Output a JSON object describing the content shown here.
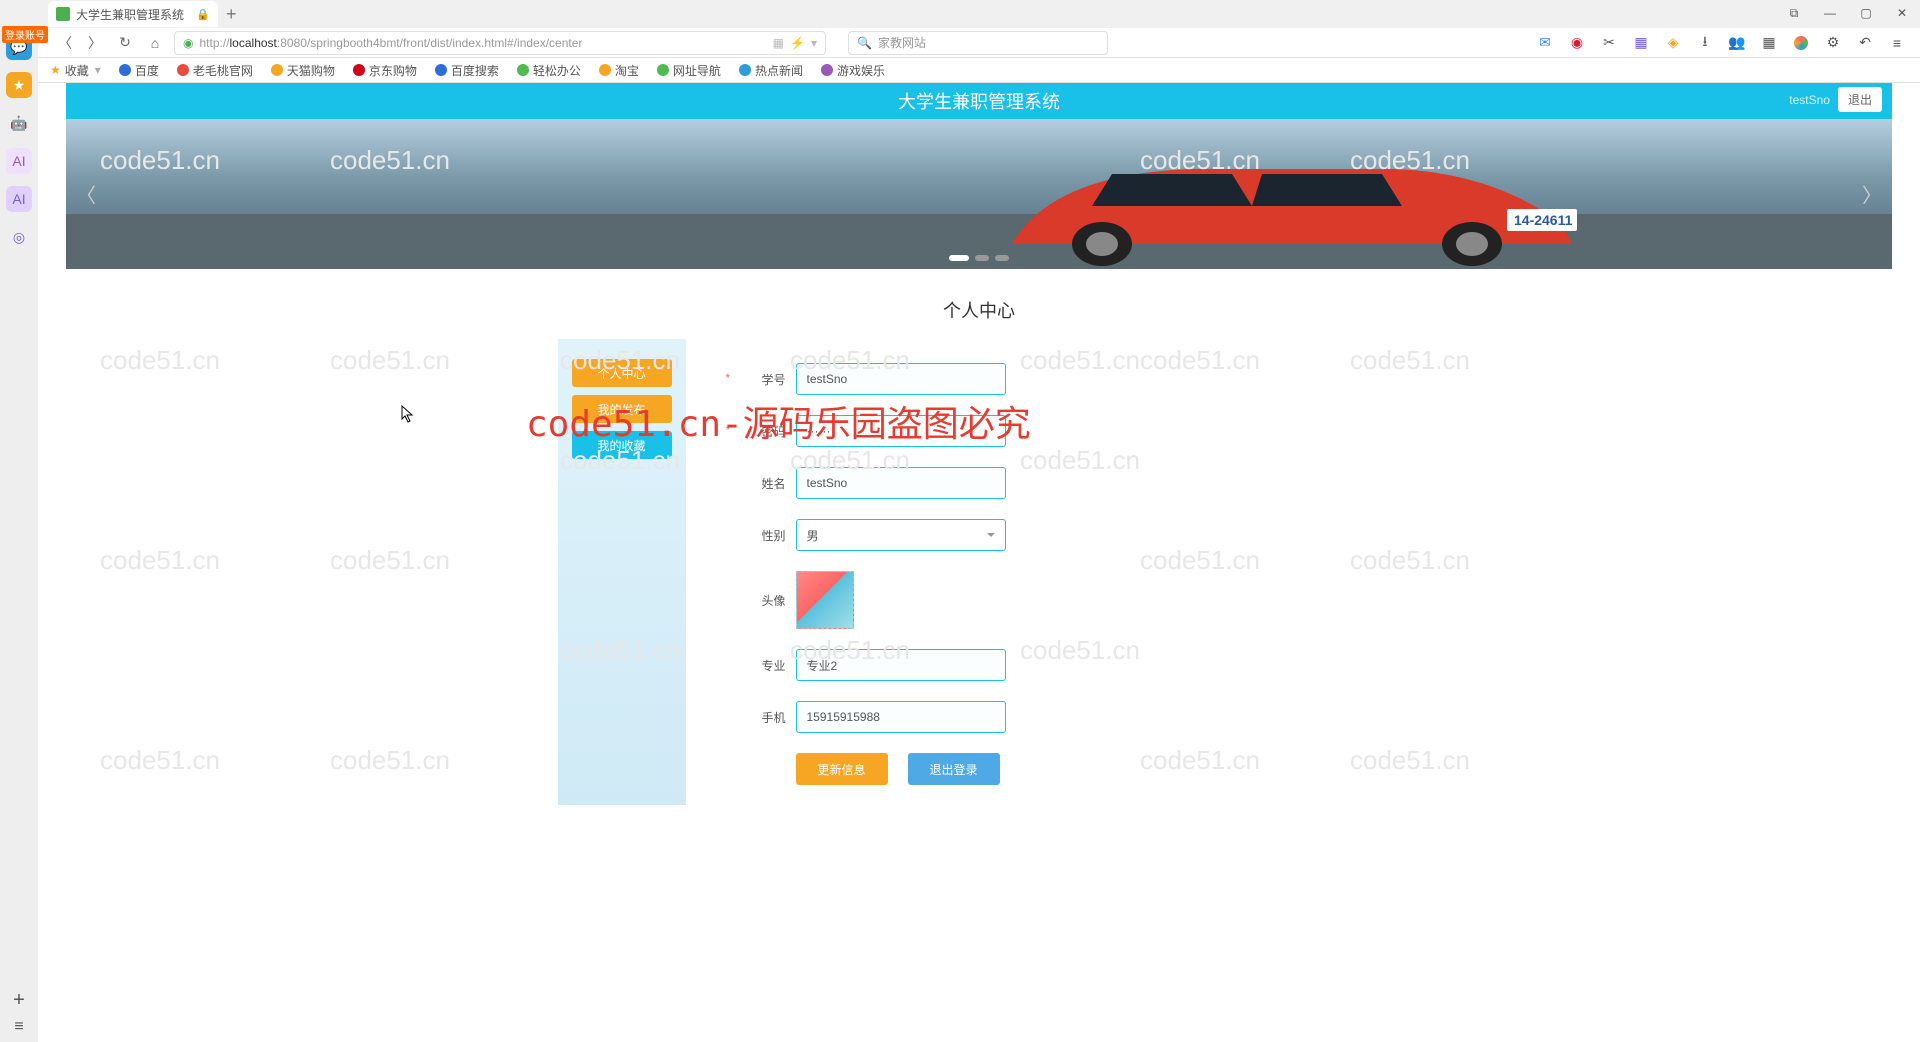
{
  "browser": {
    "tab_title": "大学生兼职管理系统",
    "login_badge": "登录账号",
    "url_prefix": "http://",
    "url_host": "localhost",
    "url_port_path": ":8080/springbooth4bmt/front/dist/index.html#/index/center",
    "search_placeholder": "家教网站"
  },
  "bookmarks": {
    "fav": "收藏",
    "items": [
      "百度",
      "老毛桃官网",
      "天猫购物",
      "京东购物",
      "百度搜索",
      "轻松办公",
      "淘宝",
      "网址导航",
      "热点新闻",
      "游戏娱乐"
    ]
  },
  "app": {
    "title": "大学生兼职管理系统",
    "username": "testSno",
    "logout": "退出"
  },
  "page": {
    "title": "个人中心",
    "sidebar": {
      "personal_center": "个人中心",
      "my_posts": "我的发布",
      "my_favorites": "我的收藏"
    },
    "form": {
      "student_id_label": "学号",
      "student_id_value": "testSno",
      "password_label": "密码",
      "password_value": "······",
      "name_label": "姓名",
      "name_value": "testSno",
      "gender_label": "性别",
      "gender_value": "男",
      "avatar_label": "头像",
      "major_label": "专业",
      "major_value": "专业2",
      "phone_label": "手机",
      "phone_value": "15915915988",
      "update_btn": "更新信息",
      "exit_btn": "退出登录"
    }
  },
  "watermark_text": "code51.cn",
  "big_watermark": "code51.cn-源码乐园盗图必究"
}
